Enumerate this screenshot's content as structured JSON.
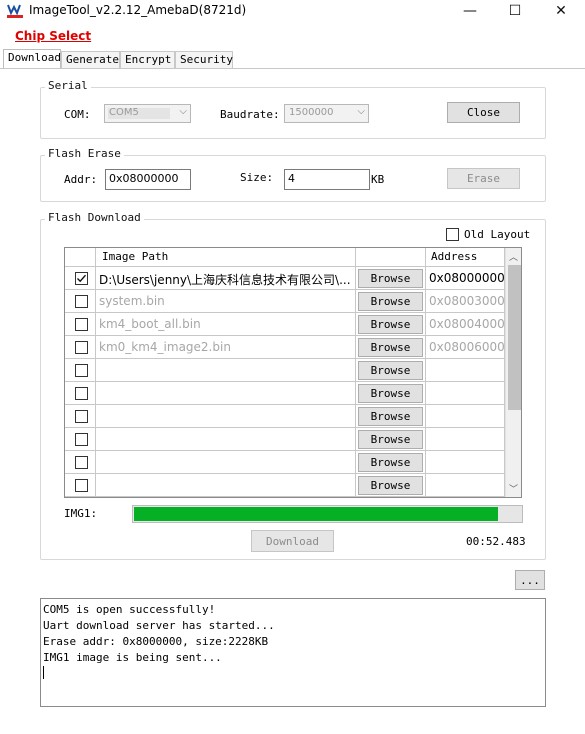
{
  "window": {
    "title": "ImageTool_v2.2.12_AmebaD(8721d)",
    "min_glyph": "—",
    "max_glyph": "☐",
    "close_glyph": "✕"
  },
  "chip_select": "Chip Select",
  "tabs": [
    {
      "label": "Download",
      "active": true
    },
    {
      "label": "Generate",
      "active": false
    },
    {
      "label": "Encrypt",
      "active": false
    },
    {
      "label": "Security",
      "active": false
    }
  ],
  "serial": {
    "title": "Serial",
    "com_label": "COM:",
    "com_value": "COM5",
    "baud_label": "Baudrate:",
    "baud_value": "1500000",
    "close_button": "Close"
  },
  "flash_erase": {
    "title": "Flash Erase",
    "addr_label": "Addr:",
    "addr_value": "0x08000000",
    "size_label": "Size:",
    "size_value": "4",
    "size_unit": "KB",
    "erase_button": "Erase"
  },
  "flash_download": {
    "title": "Flash Download",
    "old_layout_label": "Old Layout",
    "old_layout_checked": false,
    "columns": {
      "path": "Image Path",
      "address": "Address"
    },
    "browse_label": "Browse",
    "rows": [
      {
        "checked": true,
        "path": "D:\\Users\\jenny\\上海庆科信息技术有限公司\\...",
        "address": "0x08000000",
        "dim": false
      },
      {
        "checked": false,
        "path": "system.bin",
        "address": "0x08003000",
        "dim": true
      },
      {
        "checked": false,
        "path": "km4_boot_all.bin",
        "address": "0x08004000",
        "dim": true
      },
      {
        "checked": false,
        "path": "km0_km4_image2.bin",
        "address": "0x08006000",
        "dim": true
      },
      {
        "checked": false,
        "path": "",
        "address": "",
        "dim": true
      },
      {
        "checked": false,
        "path": "",
        "address": "",
        "dim": true
      },
      {
        "checked": false,
        "path": "",
        "address": "",
        "dim": true
      },
      {
        "checked": false,
        "path": "",
        "address": "",
        "dim": true
      },
      {
        "checked": false,
        "path": "",
        "address": "",
        "dim": true
      },
      {
        "checked": false,
        "path": "",
        "address": "",
        "dim": true
      }
    ],
    "progress_label": "IMG1:",
    "progress_fraction": 0.94,
    "download_button": "Download",
    "elapsed": "00:52.483",
    "more_button": "..."
  },
  "log_lines": [
    "COM5 is open successfully!",
    "Uart download server has started...",
    "Erase addr: 0x8000000, size:2228KB",
    "IMG1 image is being sent..."
  ],
  "colors": {
    "progress": "#06b025",
    "chip_select": "#e00000"
  }
}
